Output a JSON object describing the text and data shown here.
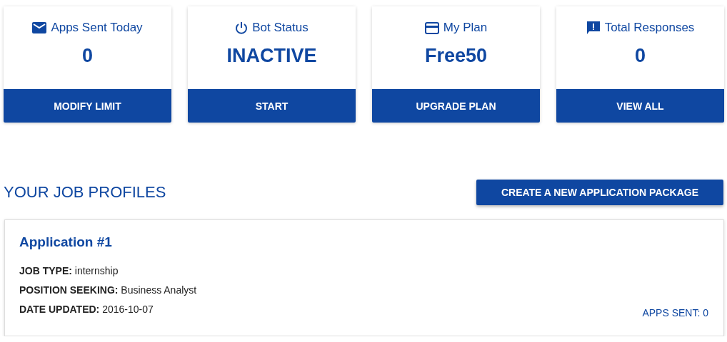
{
  "stats": [
    {
      "kind": "mail",
      "title": "Apps Sent Today",
      "value": "0",
      "action": "MODIFY LIMIT"
    },
    {
      "kind": "power",
      "title": "Bot Status",
      "value": "INACTIVE",
      "action": "START"
    },
    {
      "kind": "card",
      "title": "My Plan",
      "value": "Free50",
      "action": "UPGRADE PLAN"
    },
    {
      "kind": "alert",
      "title": "Total Responses",
      "value": "0",
      "action": "VIEW ALL"
    }
  ],
  "section": {
    "title": "YOUR JOB PROFILES",
    "button": "CREATE A NEW APPLICATION PACKAGE"
  },
  "profiles": [
    {
      "title": "Application #1",
      "details": [
        "**JOB TYPE:** internship",
        "**POSITION SEEKING:** Business Analyst",
        "**DATE UPDATED:** 2016-10-07"
      ],
      "apps_sent": "APPS SENT: 0"
    }
  ]
}
